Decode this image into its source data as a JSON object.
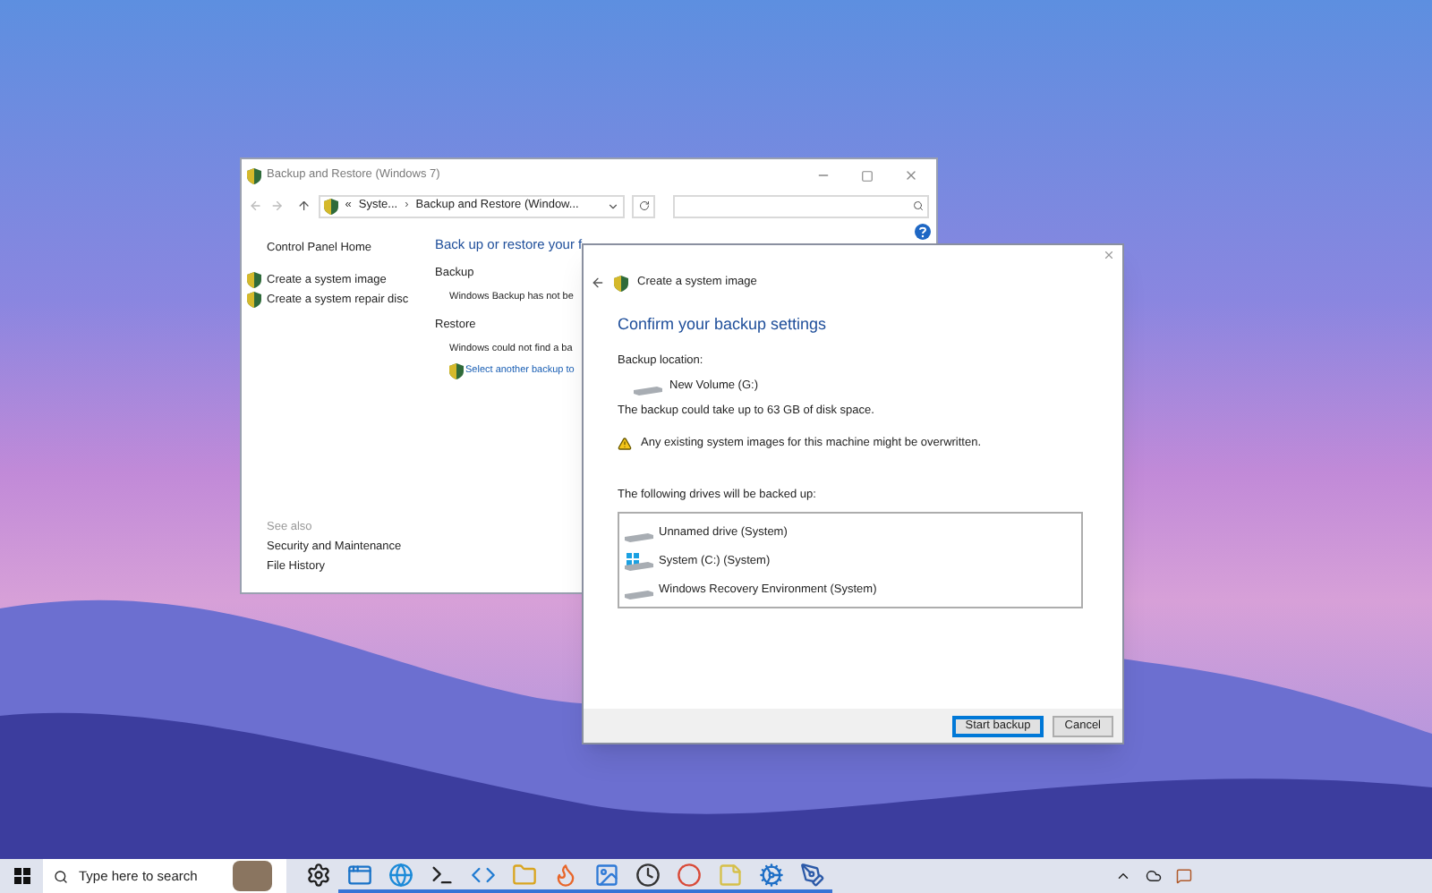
{
  "main_window": {
    "title": "Backup and Restore (Windows 7)",
    "address": {
      "crumbs": [
        "«",
        "Syste...",
        "Backup and Restore (Window..."
      ],
      "separator": "›"
    },
    "sidebar": {
      "items": [
        {
          "label": "Control Panel Home",
          "kind": "plain"
        },
        {
          "label": "Create a system image",
          "kind": "shield"
        },
        {
          "label": "Create a system repair disc",
          "kind": "shield"
        }
      ],
      "see_also": {
        "heading": "See also",
        "items": [
          "Security and Maintenance",
          "File History"
        ]
      }
    },
    "content": {
      "heading": "Back up or restore your f",
      "sections": [
        {
          "title": "Backup",
          "lines": [
            {
              "text": "Windows Backup has not be",
              "kind": "text"
            }
          ]
        },
        {
          "title": "Restore",
          "lines": [
            {
              "text": "Windows could not find a ba",
              "kind": "text"
            },
            {
              "text": "Select another backup to",
              "kind": "shield-link"
            }
          ]
        }
      ]
    }
  },
  "dialog": {
    "title": "Create a system image",
    "heading": "Confirm your backup settings",
    "location_label": "Backup location:",
    "location": "New Volume (G:)",
    "space_note": "The backup could take up to 63 GB of disk space.",
    "warning": "Any existing system images for this machine might be overwritten.",
    "drives_label": "The following drives will be backed up:",
    "drives": [
      {
        "name": "Unnamed drive (System)",
        "kind": "drive"
      },
      {
        "name": "System (C:) (System)",
        "kind": "windows"
      },
      {
        "name": "Windows Recovery Environment (System)",
        "kind": "drive"
      }
    ],
    "buttons": [
      {
        "label": "Start backup",
        "default": true
      },
      {
        "label": "Cancel",
        "default": false
      }
    ]
  },
  "taskbar": {
    "search_placeholder": "Type here to search",
    "apps": [
      {
        "kind": "gear",
        "running": false
      },
      {
        "kind": "window",
        "running": true
      },
      {
        "kind": "globe",
        "running": true
      },
      {
        "kind": "terminal",
        "running": true
      },
      {
        "kind": "code",
        "running": true
      },
      {
        "kind": "folder",
        "running": true
      },
      {
        "kind": "flame",
        "running": true
      },
      {
        "kind": "image",
        "running": true
      },
      {
        "kind": "clock",
        "running": true
      },
      {
        "kind": "circle",
        "running": true
      },
      {
        "kind": "note",
        "running": true
      },
      {
        "kind": "cog",
        "running": true
      },
      {
        "kind": "pen",
        "running": true
      }
    ]
  }
}
